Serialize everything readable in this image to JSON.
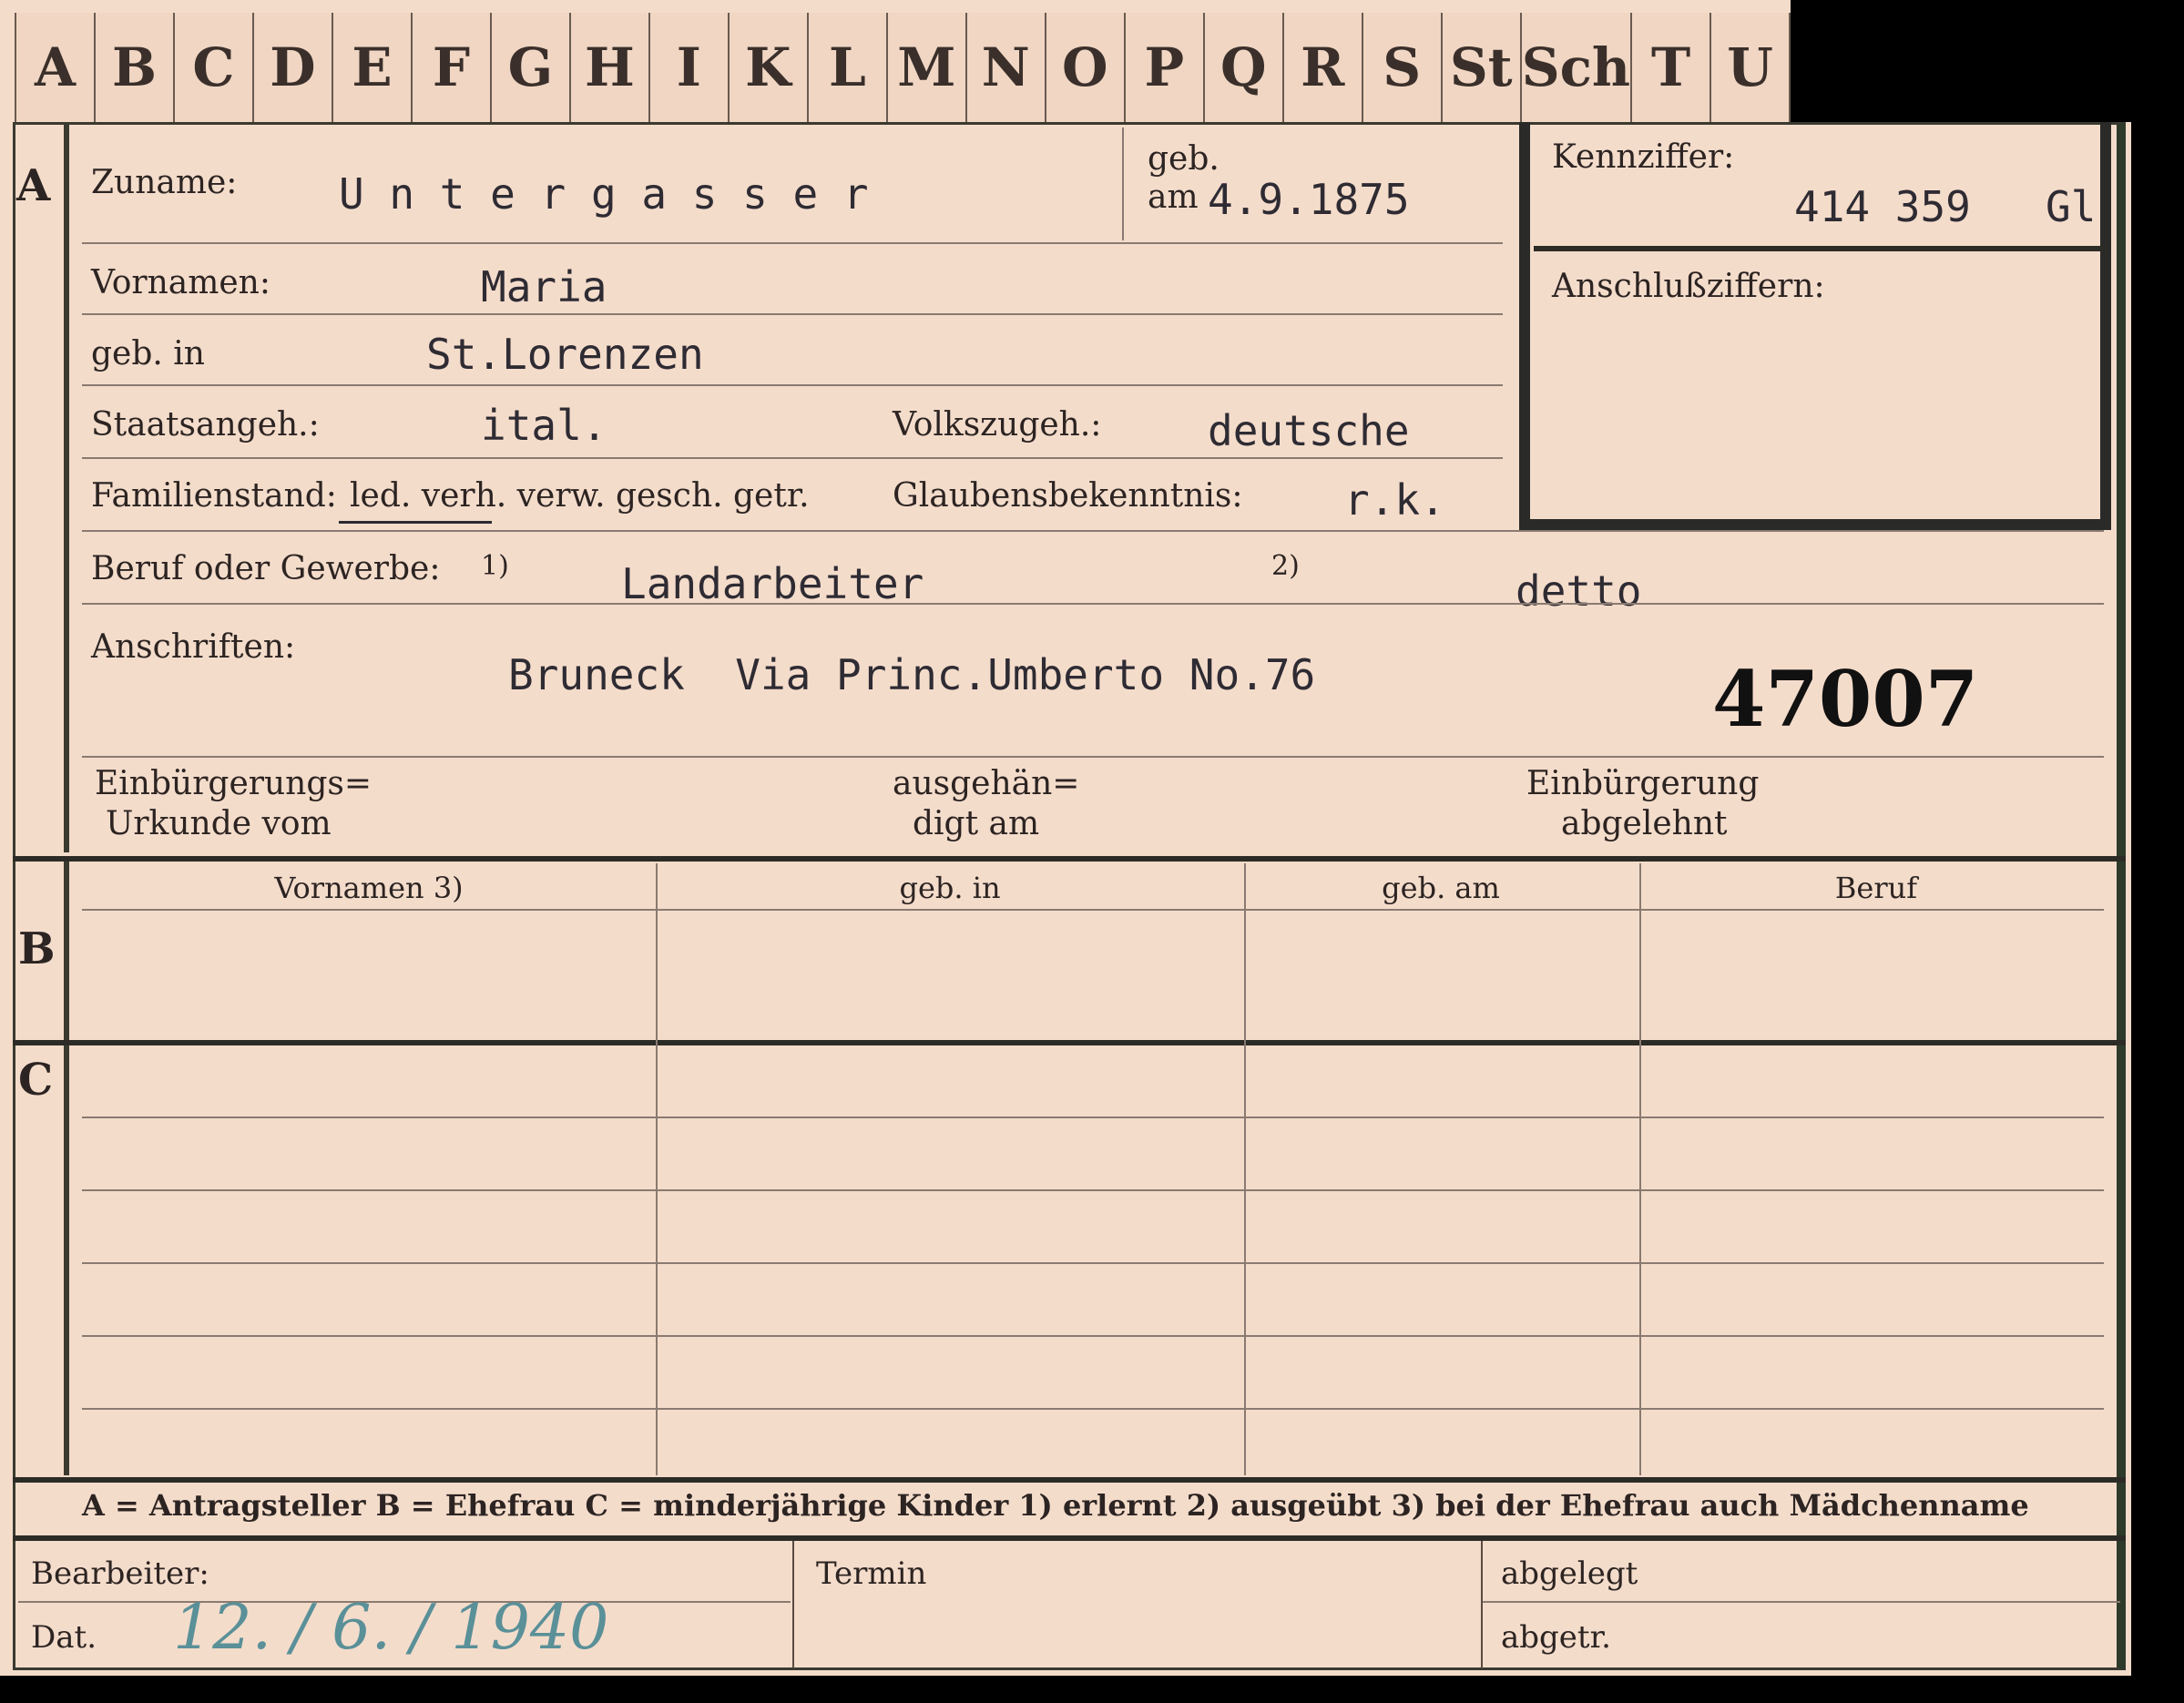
{
  "tabs": [
    "A",
    "B",
    "C",
    "D",
    "E",
    "F",
    "G",
    "H",
    "I",
    "K",
    "L",
    "M",
    "N",
    "O",
    "P",
    "Q",
    "R",
    "S",
    "St",
    "Sch",
    "T",
    "U"
  ],
  "section_a": {
    "marker": "A",
    "zuname_label": "Zuname:",
    "zuname_value": "U n t e r g a s s e r",
    "geb_label_1": "geb.",
    "geb_label_2": "am",
    "geb_date": "4.9.1875",
    "kennziffer_label": "Kennziffer:",
    "kennziffer_value": "414 359",
    "kennziffer_suffix": "Gl",
    "anschluss_label": "Anschlußziffern:",
    "vornamen_label": "Vornamen:",
    "vornamen_value": "Maria",
    "geb_in_label": "geb. in",
    "geb_in_value": "St.Lorenzen",
    "staatsangeh_label": "Staatsangeh.:",
    "staatsangeh_value": "ital.",
    "volkszugeh_label": "Volkszugeh.:",
    "volkszugeh_value": "deutsche",
    "familienstand_label": "Familienstand:",
    "familienstand_options": "led. verh. verw. gesch. getr.",
    "glauben_label": "Glaubensbekenntnis:",
    "glauben_value": "r.k.",
    "beruf_label": "Beruf oder Gewerbe:",
    "beruf_note_1": "1)",
    "beruf_value_1": "Landarbeiter",
    "beruf_note_2": "2)",
    "beruf_value_2": "detto",
    "anschriften_label": "Anschriften:",
    "anschriften_value": "Bruneck  Via Princ.Umberto No.76",
    "file_number": "47007",
    "einb_urkunde_1": "Einbürgerungs=",
    "einb_urkunde_2": "Urkunde vom",
    "ausgehaendigt_1": "ausgehän=",
    "ausgehaendigt_2": "digt am",
    "einb_abgelehnt_1": "Einbürgerung",
    "einb_abgelehnt_2": "abgelehnt"
  },
  "section_b": {
    "marker": "B",
    "columns": [
      "Vornamen 3)",
      "geb. in",
      "geb. am",
      "Beruf"
    ]
  },
  "section_c": {
    "marker": "C"
  },
  "legend": "A = Antragsteller   B = Ehefrau   C = minderjährige Kinder   1) erlernt   2) ausgeübt   3) bei der Ehefrau auch Mädchenname",
  "footer": {
    "bearbeiter_label": "Bearbeiter:",
    "dat_label": "Dat.",
    "dat_value": "12. / 6. / 1940",
    "termin_label": "Termin",
    "abgelegt_label": "abgelegt",
    "abgetr_label": "abgetr."
  }
}
